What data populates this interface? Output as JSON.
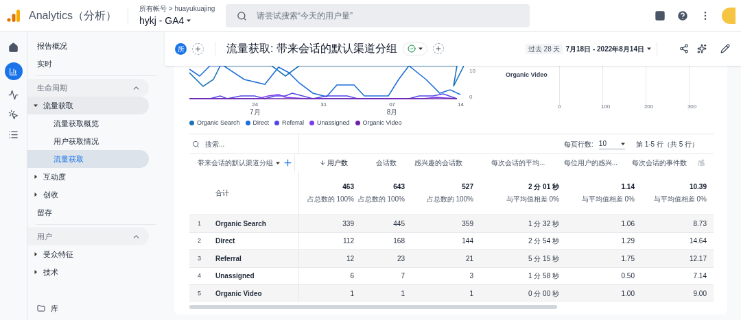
{
  "app": {
    "name": "Analytics（分析）",
    "breadcrumb": "所有帐号 > huayukuajing",
    "property": "hykj - GA4",
    "search_placeholder": "请尝试搜索“今天的用户量”"
  },
  "sidebar": {
    "items": [
      {
        "label": "报告概况",
        "kind": "link",
        "selected": false
      },
      {
        "label": "实时",
        "kind": "link",
        "selected": false
      },
      {
        "label": "生命周期",
        "kind": "section",
        "expanded": true
      },
      {
        "label": "流量获取",
        "kind": "group",
        "expanded": true,
        "children": [
          {
            "label": "流量获取概览",
            "selected": false
          },
          {
            "label": "用户获取情况",
            "selected": false
          },
          {
            "label": "流量获取",
            "selected": true
          }
        ]
      },
      {
        "label": "互动度",
        "kind": "group",
        "expanded": false
      },
      {
        "label": "创收",
        "kind": "group",
        "expanded": false
      },
      {
        "label": "留存",
        "kind": "link",
        "selected": false
      },
      {
        "label": "用户",
        "kind": "section",
        "expanded": true
      },
      {
        "label": "受众特征",
        "kind": "group",
        "expanded": false
      },
      {
        "label": "技术",
        "kind": "group",
        "expanded": false
      },
      {
        "label": "库",
        "kind": "library",
        "selected": false
      }
    ]
  },
  "report": {
    "badge": "所",
    "title": "流量获取: 带来会话的默认渠道分组",
    "date_prefix": "过去 28 天",
    "date_range": "7月18日 - 2022年8月14日"
  },
  "line_chart": {
    "y_labels": [
      "10",
      "0"
    ],
    "x_labels": [
      {
        "day": "24",
        "month": "7月"
      },
      {
        "day": "31"
      },
      {
        "day": "07",
        "month": "8月"
      },
      {
        "day": "14"
      }
    ],
    "legend": [
      {
        "name": "Organic Search",
        "color": "#1a73b8"
      },
      {
        "name": "Direct",
        "color": "#1e6fd9"
      },
      {
        "name": "Referral",
        "color": "#4f46e5"
      },
      {
        "name": "Unassigned",
        "color": "#7c3aed"
      },
      {
        "name": "Organic Video",
        "color": "#6b21a8"
      }
    ]
  },
  "bar_chart": {
    "category": "Organic Video",
    "x_labels": [
      "0",
      "100",
      "200",
      "300"
    ]
  },
  "table": {
    "search_placeholder": "搜索...",
    "rows_per_page_label": "每页行数:",
    "rows_per_page": "10",
    "range": "第 1-5 行（共 5 行）",
    "dimension_header": "带来会话的默认渠道分组",
    "columns": [
      {
        "label": "用户数",
        "sorted": true
      },
      {
        "label": "会话数",
        "sorted": false
      },
      {
        "label": "感兴趣的会话数",
        "sorted": false
      },
      {
        "label": "每次会话的平均...",
        "sorted": false
      },
      {
        "label": "每位用户的感兴...",
        "sorted": false
      },
      {
        "label": "每次会话的事件数",
        "sorted": false
      },
      {
        "label": "感",
        "sorted": false
      }
    ],
    "total": {
      "label": "合计",
      "values": [
        {
          "value": "463",
          "note": "占总数的 100%"
        },
        {
          "value": "643",
          "note": "占总数的 100%"
        },
        {
          "value": "527",
          "note": "占总数的 100%"
        },
        {
          "value": "2 分 01 秒",
          "note": "与平均值相差 0%"
        },
        {
          "value": "1.14",
          "note": "与平均值相差 0%"
        },
        {
          "value": "10.39",
          "note": "与平均值相差 0%"
        }
      ]
    },
    "rows": [
      {
        "index": "1",
        "name": "Organic Search",
        "values": [
          "339",
          "445",
          "359",
          "1 分 32 秒",
          "1.06",
          "8.73"
        ]
      },
      {
        "index": "2",
        "name": "Direct",
        "values": [
          "112",
          "168",
          "144",
          "2 分 54 秒",
          "1.29",
          "14.64"
        ]
      },
      {
        "index": "3",
        "name": "Referral",
        "values": [
          "12",
          "23",
          "21",
          "5 分 15 秒",
          "1.75",
          "12.17"
        ]
      },
      {
        "index": "4",
        "name": "Unassigned",
        "values": [
          "6",
          "7",
          "3",
          "1 分 58 秒",
          "0.50",
          "7.14"
        ]
      },
      {
        "index": "5",
        "name": "Organic Video",
        "values": [
          "1",
          "1",
          "1",
          "0 分 00 秒",
          "1.00",
          "9.00"
        ]
      }
    ]
  }
}
